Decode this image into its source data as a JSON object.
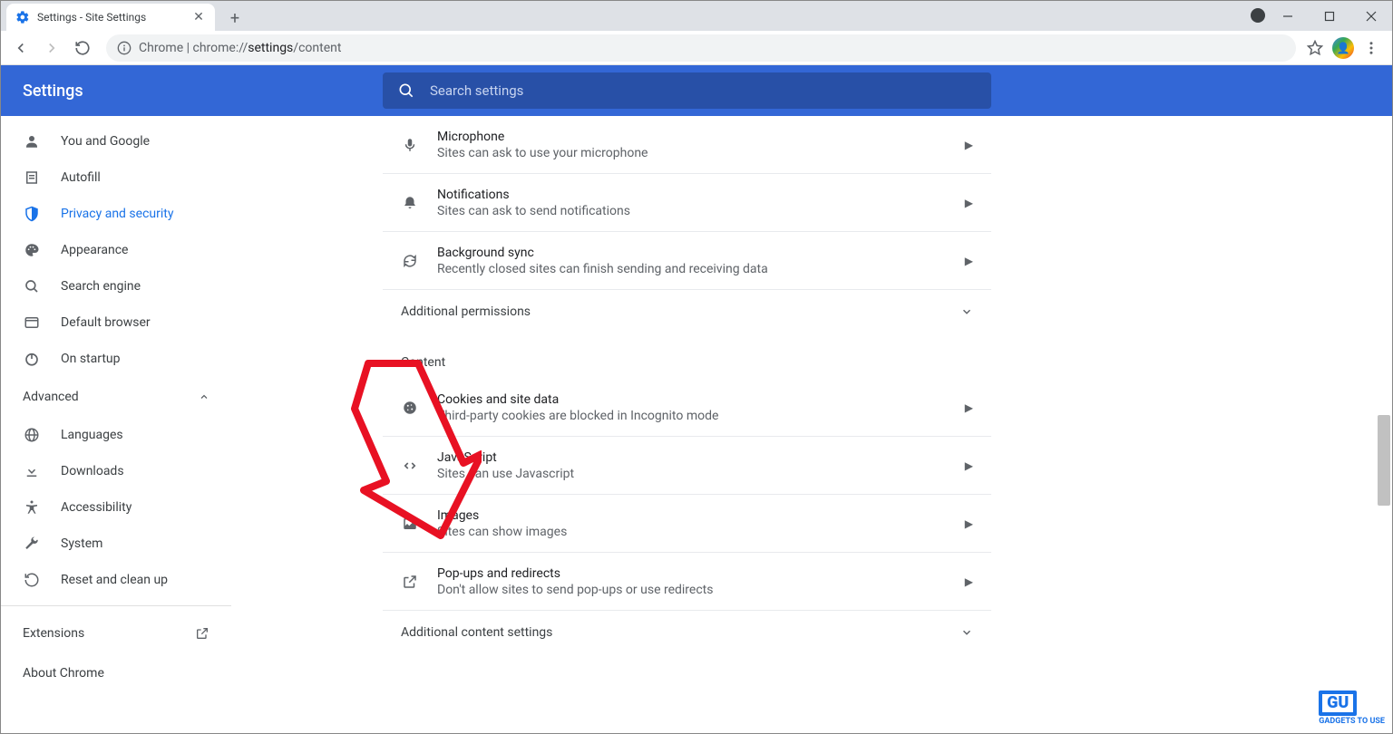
{
  "tab": {
    "title": "Settings - Site Settings"
  },
  "omnibox": {
    "prefix": "Chrome",
    "separator": " | ",
    "url_pre": "chrome://",
    "url_mid": "settings",
    "url_post": "/content"
  },
  "header": {
    "title": "Settings",
    "search_placeholder": "Search settings"
  },
  "sidebar": {
    "items": [
      {
        "label": "You and Google",
        "icon": "person"
      },
      {
        "label": "Autofill",
        "icon": "assignment"
      },
      {
        "label": "Privacy and security",
        "icon": "shield",
        "active": true
      },
      {
        "label": "Appearance",
        "icon": "palette"
      },
      {
        "label": "Search engine",
        "icon": "search"
      },
      {
        "label": "Default browser",
        "icon": "browser"
      },
      {
        "label": "On startup",
        "icon": "power"
      }
    ],
    "advanced_label": "Advanced",
    "advanced_items": [
      {
        "label": "Languages",
        "icon": "globe"
      },
      {
        "label": "Downloads",
        "icon": "download"
      },
      {
        "label": "Accessibility",
        "icon": "accessibility"
      },
      {
        "label": "System",
        "icon": "wrench"
      },
      {
        "label": "Reset and clean up",
        "icon": "restore"
      }
    ],
    "extensions_label": "Extensions",
    "about_label": "About Chrome"
  },
  "permissions": [
    {
      "title": "Microphone",
      "sub": "Sites can ask to use your microphone",
      "icon": "mic"
    },
    {
      "title": "Notifications",
      "sub": "Sites can ask to send notifications",
      "icon": "bell"
    },
    {
      "title": "Background sync",
      "sub": "Recently closed sites can finish sending and receiving data",
      "icon": "sync"
    }
  ],
  "additional_permissions_label": "Additional permissions",
  "content_label": "Content",
  "content_items": [
    {
      "title": "Cookies and site data",
      "sub": "Third-party cookies are blocked in Incognito mode",
      "icon": "cookie"
    },
    {
      "title": "JavaScript",
      "sub": "Sites can use Javascript",
      "icon": "code"
    },
    {
      "title": "Images",
      "sub": "Sites can show images",
      "icon": "image"
    },
    {
      "title": "Pop-ups and redirects",
      "sub": "Don't allow sites to send pop-ups or use redirects",
      "icon": "launch"
    }
  ],
  "additional_content_label": "Additional content settings",
  "watermark": "GADGETS TO USE"
}
